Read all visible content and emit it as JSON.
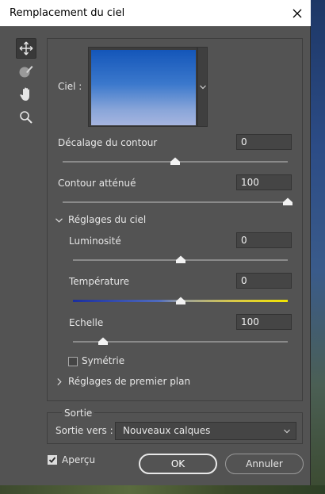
{
  "dialog": {
    "title": "Remplacement du ciel"
  },
  "tools": [
    "move-icon",
    "brush-icon",
    "hand-icon",
    "zoom-icon"
  ],
  "sky": {
    "label": "Ciel :",
    "colors": {
      "top": "#1456b9",
      "bottom": "#a6b5e0"
    }
  },
  "edge_shift": {
    "label": "Décalage du contour",
    "value": "0",
    "slider": 0.5
  },
  "fade_edge": {
    "label": "Contour atténué",
    "value": "100",
    "slider": 1.0
  },
  "sky_adjustments": {
    "label": "Réglages du ciel",
    "brightness": {
      "label": "Luminosité",
      "value": "0",
      "slider": 0.5
    },
    "temperature": {
      "label": "Température",
      "value": "0",
      "slider": 0.5
    },
    "scale": {
      "label": "Echelle",
      "value": "100",
      "slider": 0.14
    },
    "flip": {
      "label": "Symétrie",
      "checked": false
    }
  },
  "foreground_adjustments": {
    "label": "Réglages de premier plan"
  },
  "output": {
    "group_label": "Sortie",
    "label": "Sortie vers :",
    "selected": "Nouveaux calques"
  },
  "preview": {
    "label": "Aperçu",
    "checked": true
  },
  "buttons": {
    "ok": "OK",
    "cancel": "Annuler"
  }
}
